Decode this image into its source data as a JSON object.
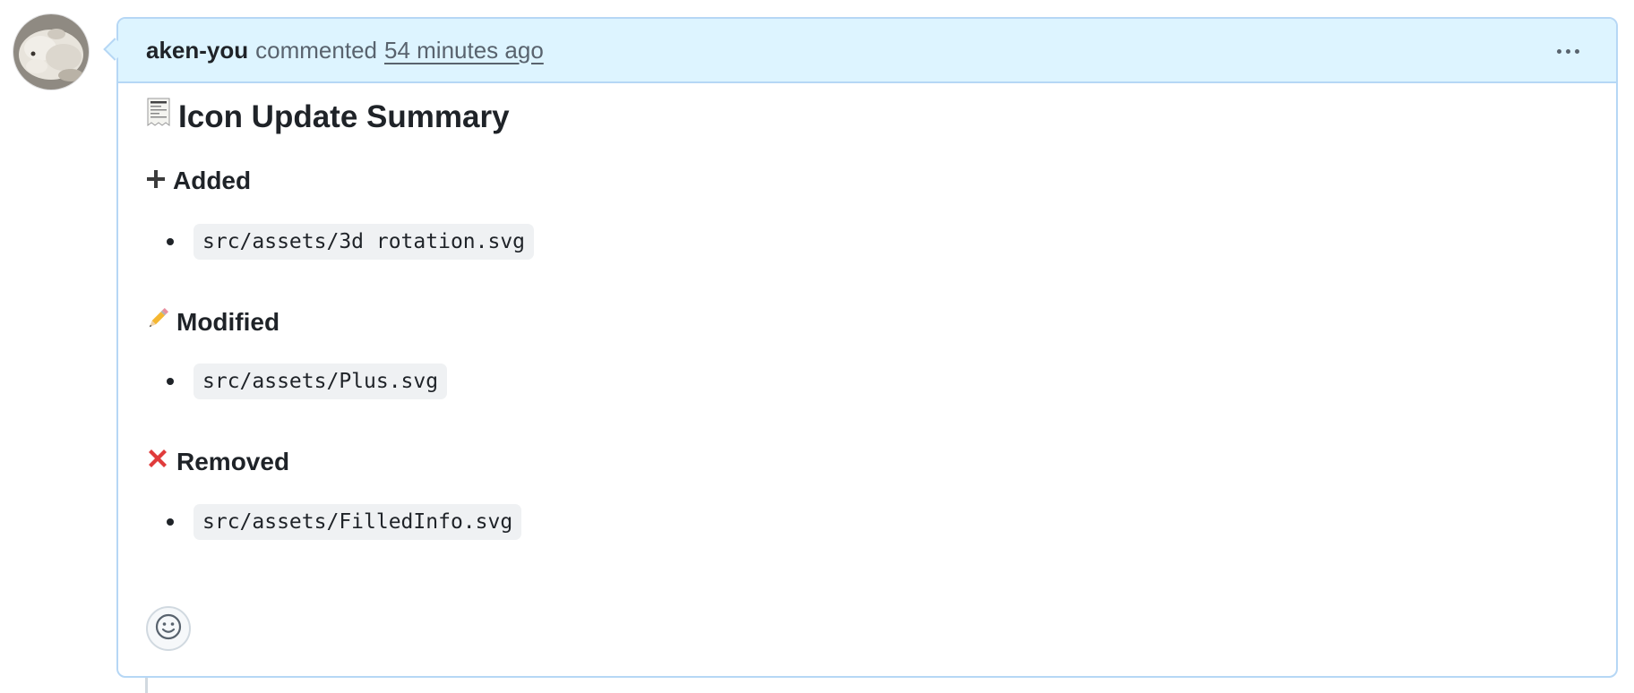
{
  "comment": {
    "author": "aken-you",
    "action": "commented",
    "timestamp": "54 minutes ago",
    "title": "Icon Update Summary",
    "sections": [
      {
        "heading": "Added",
        "emoji": "plus-icon",
        "files": [
          "src/assets/3d rotation.svg"
        ]
      },
      {
        "heading": "Modified",
        "emoji": "pencil-icon",
        "files": [
          "src/assets/Plus.svg"
        ]
      },
      {
        "heading": "Removed",
        "emoji": "cross-mark-icon",
        "files": [
          "src/assets/FilledInfo.svg"
        ]
      }
    ]
  },
  "colors": {
    "header_bg": "#ddf4ff",
    "border": "#b6d7f5",
    "text": "#1f2328",
    "muted": "#59636e",
    "removed_red": "#e03b3b"
  }
}
